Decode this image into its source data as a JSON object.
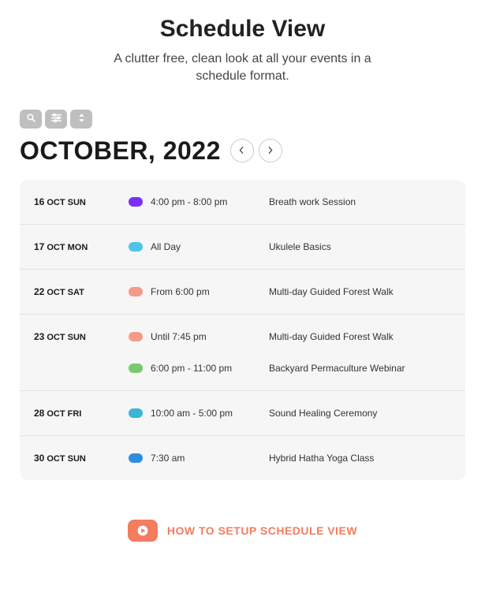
{
  "header": {
    "title": "Schedule View",
    "subtitle": "A clutter free, clean look at all your events in a schedule format."
  },
  "month": "OCTOBER, 2022",
  "colors": {
    "purple": "#7b2ff2",
    "cyan": "#4fc3e8",
    "salmon": "#f59a8a",
    "green": "#7bc96f",
    "teal": "#3bb4d6",
    "blue": "#2e8edb"
  },
  "days": [
    {
      "dayNum": "16",
      "dayLabel": "OCT SUN",
      "events": [
        {
          "color": "purple",
          "time": "4:00 pm - 8:00 pm",
          "title": "Breath work Session"
        }
      ]
    },
    {
      "dayNum": "17",
      "dayLabel": "OCT MON",
      "events": [
        {
          "color": "cyan",
          "time": "All Day",
          "title": "Ukulele Basics"
        }
      ]
    },
    {
      "dayNum": "22",
      "dayLabel": "OCT SAT",
      "events": [
        {
          "color": "salmon",
          "time": "From 6:00 pm",
          "title": "Multi-day Guided Forest Walk"
        }
      ]
    },
    {
      "dayNum": "23",
      "dayLabel": "OCT SUN",
      "events": [
        {
          "color": "salmon",
          "time": "Until 7:45 pm",
          "title": "Multi-day Guided Forest Walk"
        },
        {
          "color": "green",
          "time": "6:00 pm - 11:00 pm",
          "title": "Backyard Permaculture Webinar"
        }
      ]
    },
    {
      "dayNum": "28",
      "dayLabel": "OCT FRI",
      "events": [
        {
          "color": "teal",
          "time": "10:00 am - 5:00 pm",
          "title": "Sound Healing Ceremony"
        }
      ]
    },
    {
      "dayNum": "30",
      "dayLabel": "OCT SUN",
      "events": [
        {
          "color": "blue",
          "time": "7:30 am",
          "title": "Hybrid Hatha Yoga Class"
        }
      ]
    }
  ],
  "footer": {
    "label": "HOW TO SETUP SCHEDULE VIEW"
  }
}
